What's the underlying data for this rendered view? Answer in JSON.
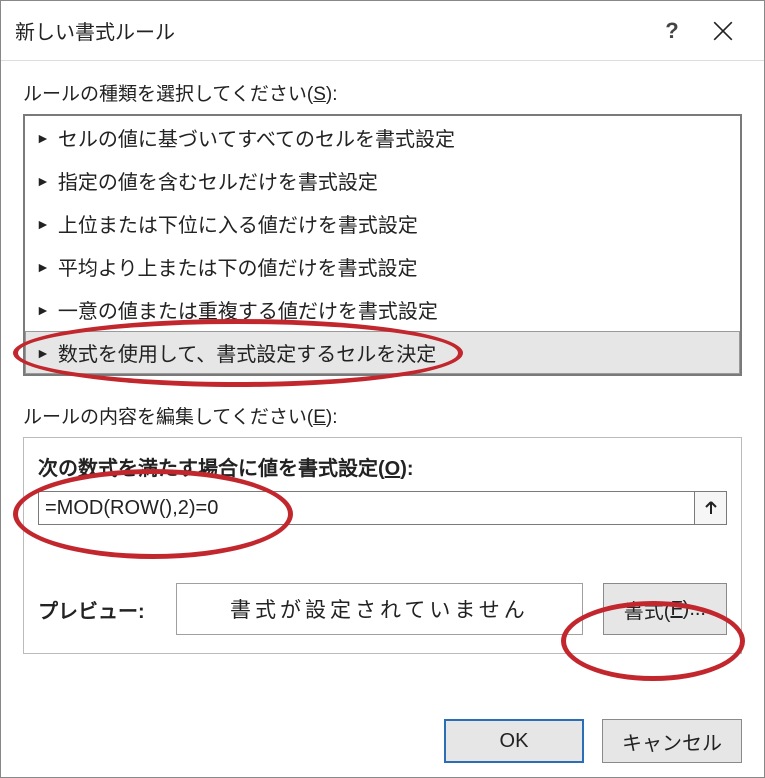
{
  "title": "新しい書式ルール",
  "help_symbol": "?",
  "rule_type": {
    "label_prefix": "ルールの種類を選択してください(",
    "accel": "S",
    "label_suffix": "):",
    "items": [
      "セルの値に基づいてすべてのセルを書式設定",
      "指定の値を含むセルだけを書式設定",
      "上位または下位に入る値だけを書式設定",
      "平均より上または下の値だけを書式設定",
      "一意の値または重複する値だけを書式設定",
      "数式を使用して、書式設定するセルを決定"
    ],
    "selected_index": 5
  },
  "rule_edit": {
    "label_prefix": "ルールの内容を編集してください(",
    "accel": "E",
    "label_suffix": "):",
    "formula_heading_prefix": "次の数式を満たす場合に値を書式設定(",
    "formula_accel": "O",
    "formula_heading_suffix": "):",
    "formula_value": "=MOD(ROW(),2)=0"
  },
  "preview": {
    "label": "プレビュー:",
    "text": "書式が設定されていません",
    "format_prefix": "書式(",
    "format_accel": "F",
    "format_suffix": ")..."
  },
  "buttons": {
    "ok": "OK",
    "cancel": "キャンセル"
  }
}
